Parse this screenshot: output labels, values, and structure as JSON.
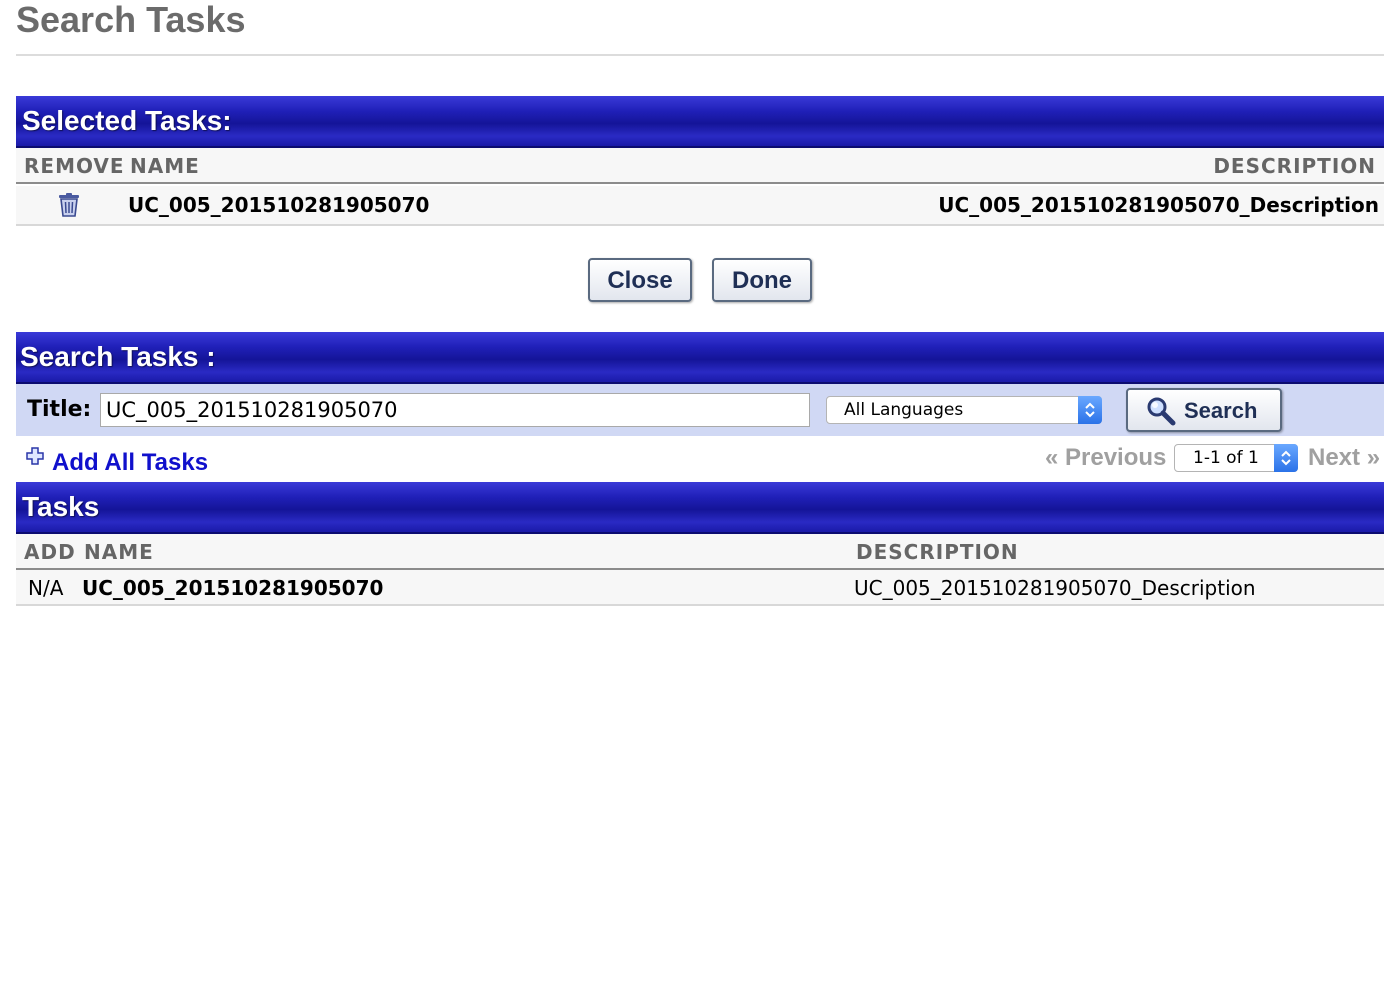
{
  "page": {
    "title": "Search Tasks"
  },
  "selected": {
    "header": "Selected Tasks:",
    "columns": {
      "remove": "REMOVE",
      "name": "NAME",
      "description": "DESCRIPTION"
    },
    "rows": [
      {
        "name": "UC_005_201510281905070",
        "description": "UC_005_201510281905070_Description",
        "remove_icon": "trash-icon"
      }
    ]
  },
  "actions": {
    "close": "Close",
    "done": "Done"
  },
  "search": {
    "header": "Search Tasks :",
    "title_label": "Title:",
    "title_value": "UC_005_201510281905070",
    "language": "All Languages",
    "button": "Search",
    "button_icon": "magnifier-icon"
  },
  "add_all": "Add All Tasks",
  "pager": {
    "previous": "« Previous",
    "range": "1-1 of 1",
    "next": "Next »"
  },
  "tasks": {
    "header": "Tasks",
    "columns": {
      "add": "ADD",
      "name": "NAME",
      "description": "DESCRIPTION"
    },
    "rows": [
      {
        "add": "N/A",
        "name": "UC_005_201510281905070",
        "description": "UC_005_201510281905070_Description"
      }
    ]
  },
  "colors": {
    "bar_blue": "#1a1aa8",
    "filter_bg": "#d0d8f4",
    "link_blue": "#1010cc"
  }
}
